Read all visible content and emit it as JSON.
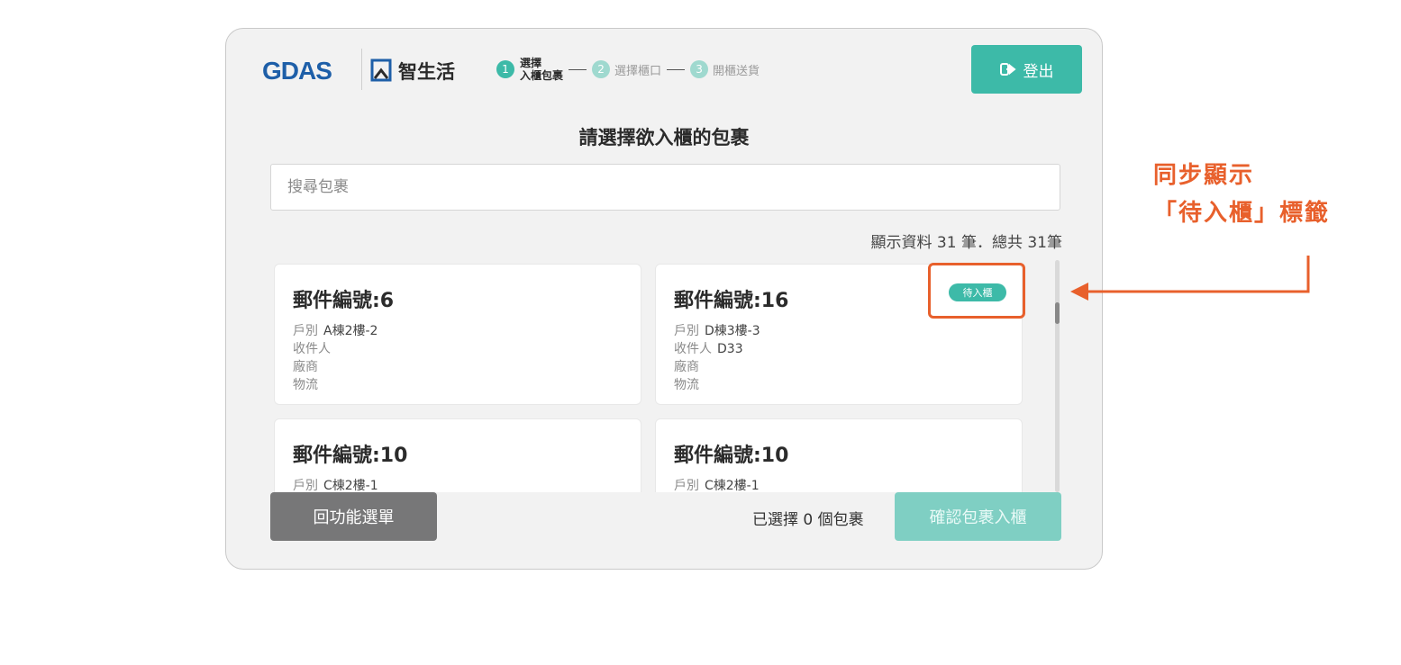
{
  "header": {
    "logo_text": "GDAS",
    "brand_name": "智生活",
    "steps": [
      {
        "num": "1",
        "label_line1": "選擇",
        "label_line2": "入櫃包裹"
      },
      {
        "num": "2",
        "label": "選擇櫃口"
      },
      {
        "num": "3",
        "label": "開櫃送貨"
      }
    ],
    "logout_label": "登出"
  },
  "main": {
    "title": "請選擇欲入櫃的包裹",
    "search_placeholder": "搜尋包裹",
    "count_text": "顯示資料 31 筆．總共 31筆"
  },
  "cards": [
    {
      "title": "郵件編號:6",
      "unit_label": "戶別",
      "unit": "A棟2樓-2",
      "recipient_label": "收件人",
      "recipient": "",
      "vendor_label": "廠商",
      "logistics_label": "物流"
    },
    {
      "title": "郵件編號:16",
      "unit_label": "戶別",
      "unit": "D棟3樓-3",
      "recipient_label": "收件人",
      "recipient": "D33",
      "vendor_label": "廠商",
      "logistics_label": "物流",
      "tag": "待入櫃"
    },
    {
      "title": "郵件編號:10",
      "unit_label": "戶別",
      "unit": "C棟2樓-1"
    },
    {
      "title": "郵件編號:10",
      "unit_label": "戶別",
      "unit": "C棟2樓-1"
    }
  ],
  "footer": {
    "back_label": "回功能選單",
    "selected_prefix": "已選擇",
    "selected_count": "0",
    "selected_suffix": "個包裹",
    "confirm_label": "確認包裹入櫃"
  },
  "annotation": {
    "line1": "同步顯示",
    "line2": "「待入櫃」標籤"
  },
  "colors": {
    "accent": "#3dbaa8",
    "accent_disabled": "#7fcfc3",
    "annotation": "#e8602c",
    "back_button": "#777778",
    "logo_blue": "#1e5fa8"
  }
}
